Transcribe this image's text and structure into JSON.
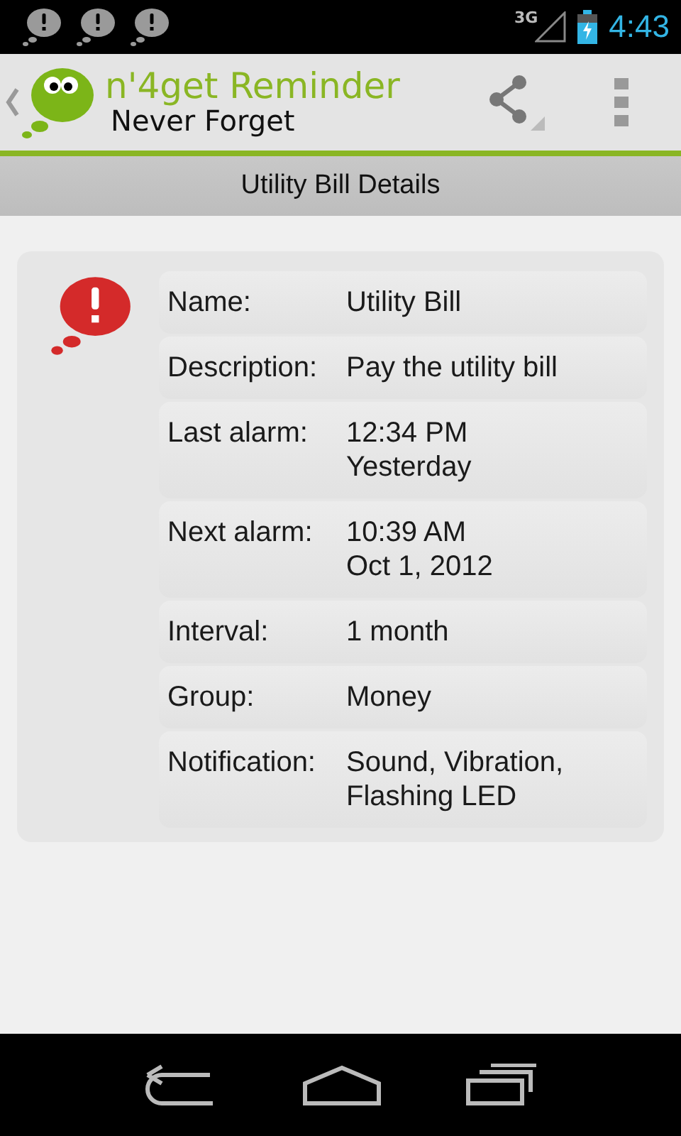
{
  "status_bar": {
    "network": "3G",
    "time": "4:43"
  },
  "action_bar": {
    "title": "n'4get Reminder",
    "subtitle": "Never Forget"
  },
  "header": {
    "title": "Utility Bill Details"
  },
  "details": [
    {
      "label": "Name:",
      "lines": [
        "Utility Bill"
      ]
    },
    {
      "label": "Description:",
      "lines": [
        "Pay the utility bill"
      ]
    },
    {
      "label": "Last alarm:",
      "lines": [
        "12:34 PM",
        "Yesterday"
      ]
    },
    {
      "label": "Next alarm:",
      "lines": [
        "10:39 AM",
        "Oct 1, 2012"
      ]
    },
    {
      "label": "Interval:",
      "lines": [
        "1 month"
      ]
    },
    {
      "label": "Group:",
      "lines": [
        "Money"
      ]
    },
    {
      "label": "Notification:",
      "lines": [
        "Sound, Vibration,",
        "Flashing LED"
      ]
    }
  ]
}
